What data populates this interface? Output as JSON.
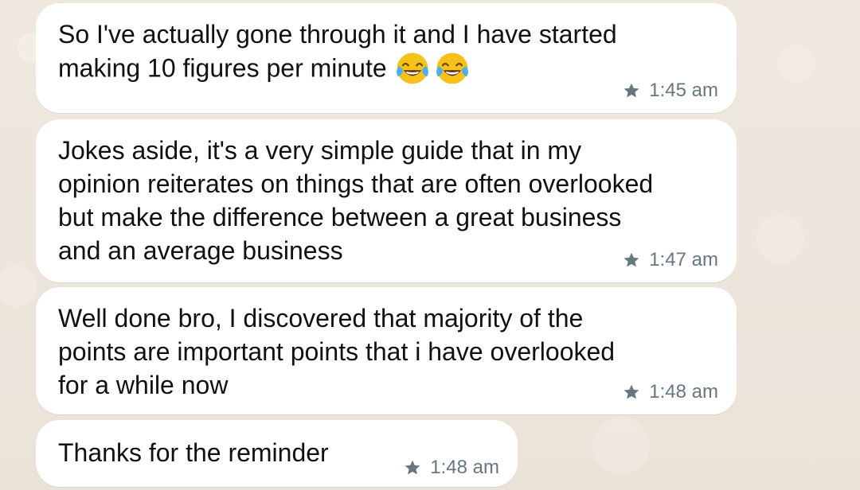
{
  "theme": {
    "bubble_color": "#ffffff",
    "text_color": "#111111",
    "meta_color": "#667781",
    "background_color": "#ece5dd"
  },
  "messages": [
    {
      "text": "So I've actually gone through it and I have started\nmaking 10 figures per minute",
      "emoji": [
        "face-with-tears-of-joy-emoji",
        "face-with-tears-of-joy-emoji"
      ],
      "time": "1:45 am",
      "starred": true
    },
    {
      "text": "Jokes aside, it's a very simple guide that in my\nopinion reiterates on things that are often overlooked\nbut make the difference between a great business\nand an average business",
      "time": "1:47 am",
      "starred": true
    },
    {
      "text": "Well done bro, I discovered that majority of the\npoints are important points that i have overlooked\nfor a while now",
      "time": "1:48 am",
      "starred": true
    },
    {
      "text": "Thanks for the reminder",
      "time": "1:48 am",
      "starred": true
    }
  ]
}
